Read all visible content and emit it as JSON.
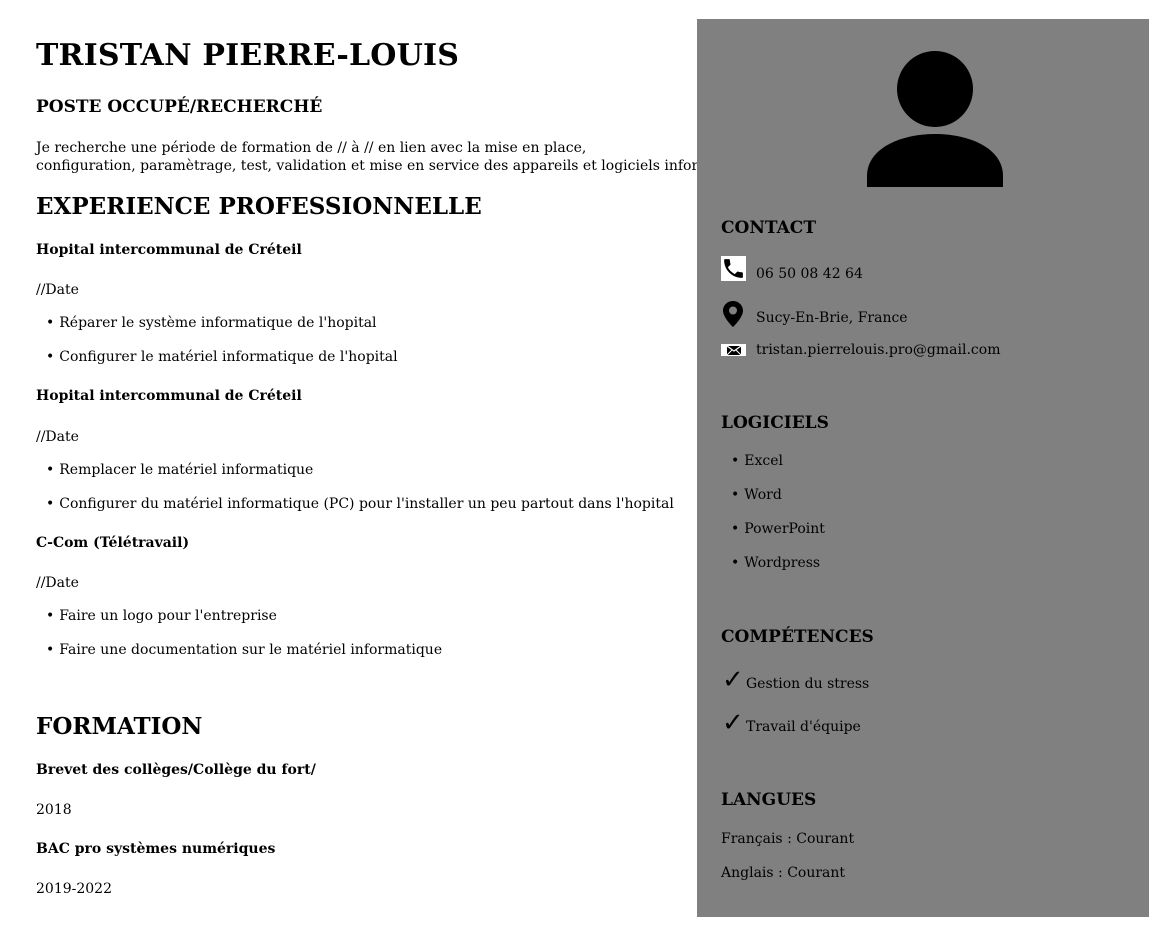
{
  "name": "TRISTAN PIERRE-LOUIS",
  "poste": {
    "title": "POSTE OCCUPÉ/RECHERCHÉ",
    "line1": "Je recherche une période de formation de // à // en lien avec la mise en place,",
    "line2": "configuration, paramètrage, test, validation et mise en service des appareils et logiciels informatique."
  },
  "experience": {
    "title": "EXPERIENCE PROFESSIONNELLE",
    "items": [
      {
        "company": "Hopital intercommunal de Créteil",
        "date": "//Date",
        "bullets": [
          "Réparer le système informatique de l'hopital",
          "Configurer le matériel informatique de l'hopital"
        ]
      },
      {
        "company": "Hopital intercommunal de Créteil",
        "date": "//Date",
        "bullets": [
          "Remplacer le matériel informatique",
          "Configurer du matériel informatique (PC) pour l'installer un peu partout dans l'hopital"
        ]
      },
      {
        "company": "C-Com (Télétravail)",
        "date": "//Date",
        "bullets": [
          "Faire un logo pour l'entreprise",
          "Faire une documentation sur le matériel informatique"
        ]
      }
    ]
  },
  "formation": {
    "title": "FORMATION",
    "items": [
      {
        "name": "Brevet des collèges/Collège du fort/",
        "year": "2018"
      },
      {
        "name": "BAC pro systèmes numériques",
        "year": "2019-2022"
      }
    ]
  },
  "sidebar": {
    "colors": {
      "background": "#808080"
    },
    "avatar_icon": "user-avatar-icon",
    "contact": {
      "title": "CONTACT",
      "phone": "06 50 08 42 64",
      "location": "Sucy-En-Brie, France",
      "email": "tristan.pierrelouis.pro@gmail.com",
      "icons": [
        "phone-icon",
        "map-pin-icon",
        "mail-icon"
      ]
    },
    "logiciels": {
      "title": "LOGICIELS",
      "items": [
        "Excel",
        "Word",
        "PowerPoint",
        "Wordpress"
      ]
    },
    "competences": {
      "title": "COMPÉTENCES",
      "items": [
        "Gestion du stress",
        "Travail d'équipe"
      ],
      "icon": "checkmark-icon"
    },
    "langues": {
      "title": "LANGUES",
      "items": [
        "Français : Courant",
        "Anglais : Courant"
      ]
    }
  }
}
